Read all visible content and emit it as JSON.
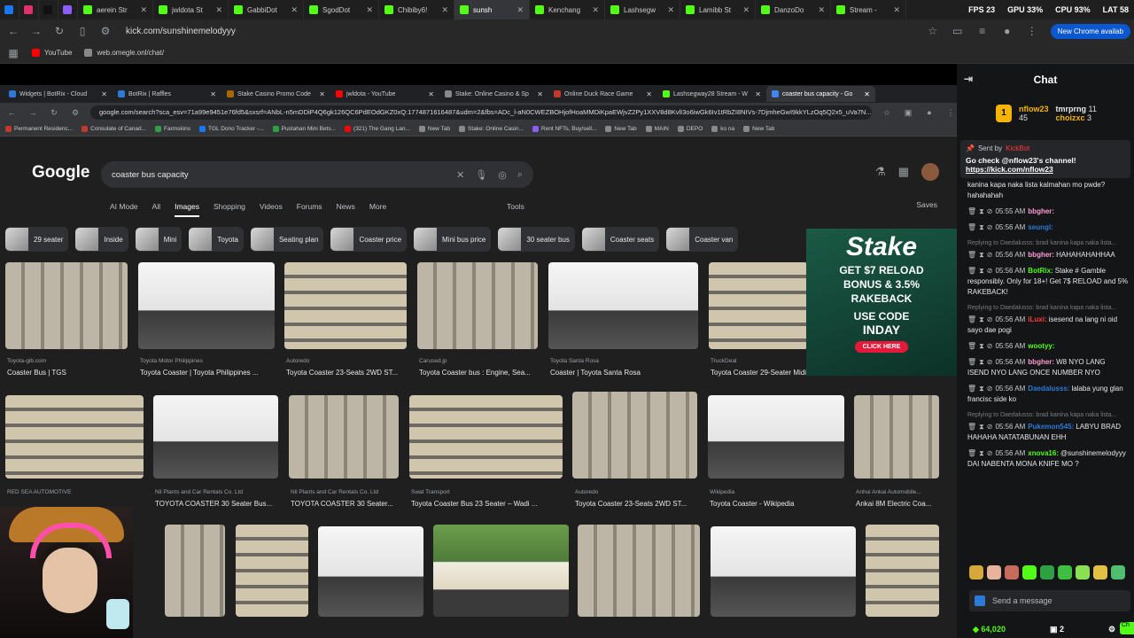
{
  "outer_tabs": [
    {
      "label": "",
      "color": "#1877f2",
      "small": true
    },
    {
      "label": "",
      "color": "#e1306c",
      "small": true
    },
    {
      "label": "",
      "color": "#111111",
      "small": true
    },
    {
      "label": "",
      "color": "#8b5cf6",
      "small": true
    },
    {
      "label": "aerein Str",
      "color": "#53fc18"
    },
    {
      "label": "jwldota St",
      "color": "#53fc18"
    },
    {
      "label": "GabbiDot",
      "color": "#53fc18"
    },
    {
      "label": "SgodDot",
      "color": "#53fc18"
    },
    {
      "label": "Chibiby6!",
      "color": "#53fc18"
    },
    {
      "label": "sunsh",
      "color": "#53fc18",
      "active": true
    },
    {
      "label": "Kenchang",
      "color": "#53fc18"
    },
    {
      "label": "Lashsegw",
      "color": "#53fc18"
    },
    {
      "label": "Lamibb St",
      "color": "#53fc18"
    },
    {
      "label": "DanzoDo",
      "color": "#53fc18"
    },
    {
      "label": "Stream -",
      "color": "#53fc18"
    }
  ],
  "sys_stats": {
    "fps": "FPS 23",
    "gpu": "GPU 33%",
    "cpu": "CPU 93%",
    "lat": "LAT 58"
  },
  "outer_url": "kick.com/sunshinemelodyyy",
  "outer_chrome_button": "New Chrome availab",
  "outer_bookmarks": [
    {
      "label": "YouTube",
      "color": "#ff0000"
    },
    {
      "label": "web.omegle.onl/chat/",
      "color": "#888888"
    }
  ],
  "inner_tabs": [
    {
      "label": "Widgets | BotRix - Cloud",
      "color": "#2b7ad6"
    },
    {
      "label": "BotRix | Raffles",
      "color": "#2b7ad6"
    },
    {
      "label": "Stake Casino Promo Code",
      "color": "#aa6600"
    },
    {
      "label": "jwldota - YouTube",
      "color": "#ff0000"
    },
    {
      "label": "Stake: Online Casino & Sp",
      "color": "#888888"
    },
    {
      "label": "Online Duck Race Game",
      "color": "#c0392b"
    },
    {
      "label": "Lashsegway28 Stream - W",
      "color": "#53fc18"
    },
    {
      "label": "coaster bus capacity - Go",
      "color": "#4285f4",
      "active": true
    }
  ],
  "inner_url": "google.com/search?sca_esv=71a99e9451e76fd5&sxsrf=ANbL-n5mDDiP4Q6gk126QC6PdEOdGKZ0xQ:1774871616487&udm=2&fbs=ADc_l-aN0CWEZBOHjofHoaMMDiKpaEWjvZ2Py1XXV8d8KvlI3o6iwGk6Iv1tRbZI8NIVs-7DjmheGwI9kkYLzOq5Q2x5_uVa7N...",
  "inner_bookmarks": [
    "Permanent Residenc...",
    "Consulate of Canad...",
    "Farmskins",
    "TGL Dono Tracker -...",
    "Pustahan Mini Bets...",
    "(321) The Gang Lan...",
    "New Tab",
    "Stake: Online Casin...",
    "Rent NFTs, Buy/sell...",
    "New Tab",
    "MAIN",
    "DEPO",
    "ko na",
    "New Tab"
  ],
  "google": {
    "logo": "Google",
    "query": "coaster bus capacity",
    "nav": [
      "AI Mode",
      "All",
      "Images",
      "Shopping",
      "Videos",
      "Forums",
      "News",
      "More"
    ],
    "tools": "Tools",
    "saves": "Saves",
    "chips": [
      "29 seater",
      "Inside",
      "Mini",
      "Toyota",
      "Seating plan",
      "Coaster price",
      "Mini bus price",
      "30 seater bus",
      "Coaster seats",
      "Coaster van"
    ],
    "row1": [
      {
        "src": "Toyota-gib.com",
        "caption": "Coaster Bus | TGS"
      },
      {
        "src": "Toyota Motor Philippines",
        "caption": "Toyota Coaster | Toyota Philippines ..."
      },
      {
        "src": "Autoredo",
        "caption": "Toyota Coaster 23-Seats 2WD ST..."
      },
      {
        "src": "Carused.jp",
        "caption": "Toyota Coaster bus : Engine, Sea..."
      },
      {
        "src": "Toyota Santa Rosa",
        "caption": "Coaster | Toyota Santa Rosa"
      },
      {
        "src": "TruckDeal",
        "caption": "Toyota Coaster 29-Seater Midi Bus 20..."
      }
    ],
    "row2": [
      {
        "src": "RED SEA AUTOMOTIVE",
        "caption": ""
      },
      {
        "src": "Nil Plants and Car Rentals Co. Ltd",
        "caption": "TOYOTA COASTER 30 Seater Bus..."
      },
      {
        "src": "Nil Plants and Car Rentals Co. Ltd",
        "caption": "TOYOTA COASTER 30 Seater..."
      },
      {
        "src": "Swat Transport",
        "caption": "Toyota Coaster Bus 23 Seater – Wadi ..."
      },
      {
        "src": "Autoredo",
        "caption": "Toyota Coaster 23-Seats 2WD ST..."
      },
      {
        "src": "Wikipedia",
        "caption": "Toyota Coaster - Wikipedia"
      },
      {
        "src": "Anhui Ankai Automobile...",
        "caption": "Ankai 8M Electric Coa..."
      }
    ]
  },
  "stake_ad": {
    "logo": "Stake",
    "line1": "GET $7 RELOAD",
    "line2": "BONUS & 3.5%",
    "line3": "RAKEBACK",
    "use": "USE CODE",
    "code": "INDAY",
    "cta": "CLICK HERE"
  },
  "chat": {
    "title": "Chat",
    "gifters": [
      {
        "rank": "1",
        "name": "nflow23",
        "count": "45"
      },
      {
        "name": "tmrprng",
        "count": "11"
      },
      {
        "name": "choizxc",
        "count": "3"
      }
    ],
    "pinned": {
      "by_label": "Sent by",
      "by_name": "KickBot",
      "text": "Go check @nflow23's channel!",
      "link": "https://kick.com/nflow23"
    },
    "messages": [
      {
        "reply": "",
        "time": "",
        "user": "",
        "color": "#ffffff",
        "text": "kanina kapa naka lista kalmahan mo pwde? hahahahah"
      },
      {
        "reply": "",
        "time": "05:55 AM",
        "user": "bbgher:",
        "color": "#ff9bd2",
        "text": ""
      },
      {
        "reply": "",
        "time": "05:56 AM",
        "user": "seungl:",
        "color": "#2b7ad6",
        "text": ""
      },
      {
        "reply": "Replying to Daedalusss: brad kanina kapa naka lista...",
        "time": "05:56 AM",
        "user": "bbgher:",
        "color": "#ff9bd2",
        "text": "HAHAHAHAHHAA"
      },
      {
        "reply": "",
        "time": "05:56 AM",
        "user": "BotRix:",
        "color": "#53fc18",
        "text": "Stake # Gamble responsibly. Only for 18+! Get 7$ RELOAD and 5% RAKEBACK!"
      },
      {
        "reply": "Replying to Daedalusss: brad kanina kapa naka lista...",
        "time": "05:56 AM",
        "user": "iLuxi:",
        "color": "#ff3b3b",
        "text": "isesend na lang ni oid sayo dae pogi"
      },
      {
        "reply": "",
        "time": "05:56 AM",
        "user": "wootyy:",
        "color": "#53fc18",
        "text": ""
      },
      {
        "reply": "",
        "time": "05:56 AM",
        "user": "bbgher:",
        "color": "#ff9bd2",
        "text": "W8 NYO LANG ISEND NYO LANG ONCE NUMBER NYO"
      },
      {
        "reply": "",
        "time": "05:56 AM",
        "user": "Daedalusss:",
        "color": "#2b7ad6",
        "text": "lalaba yung glan francisc side ko"
      },
      {
        "reply": "Replying to Daedalusss: brad kanina kapa naka lista...",
        "time": "05:56 AM",
        "user": "Pukemon545:",
        "color": "#2b7ad6",
        "text": "LABYU BRAD HAHAHA NATATABUNAN EHH"
      },
      {
        "reply": "",
        "time": "05:56 AM",
        "user": "xnova16:",
        "color": "#53fc18",
        "text": "@sunshinemelodyyy DAI NABENTA MONA KNIFE MO ?"
      }
    ],
    "input_placeholder": "Send a message",
    "points": "64,020",
    "count": "2",
    "chat_button": "Ch"
  }
}
